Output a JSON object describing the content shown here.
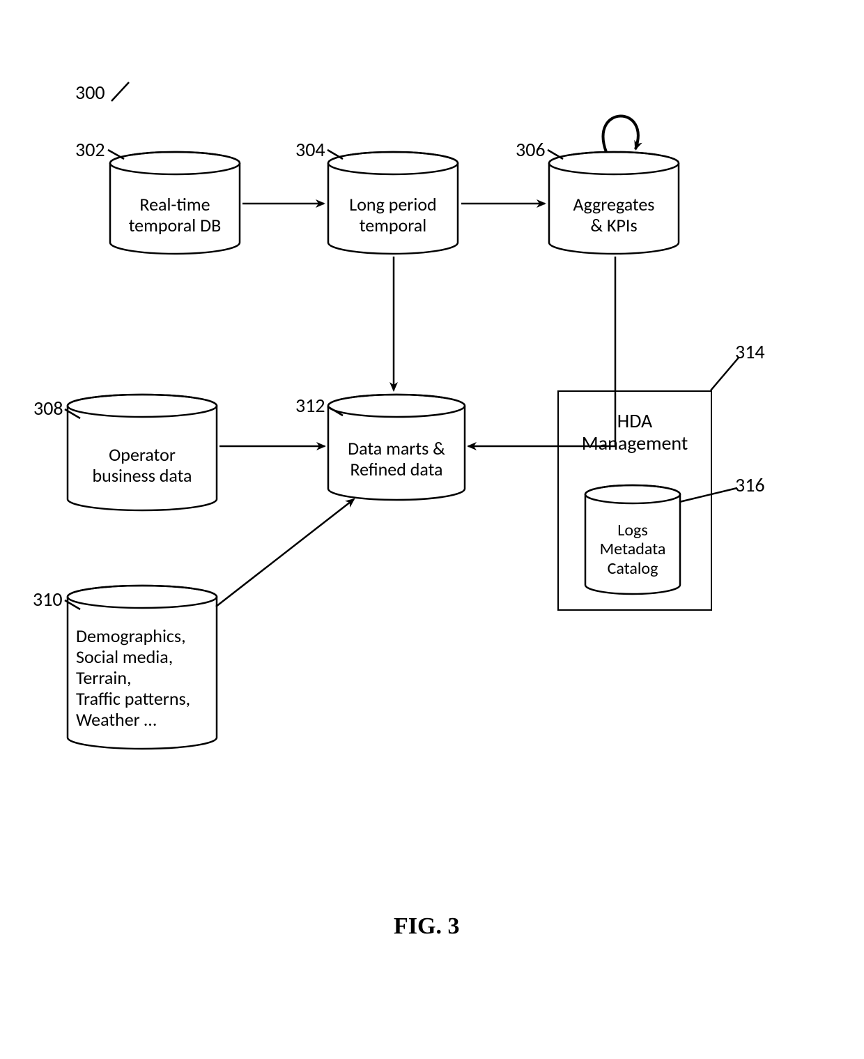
{
  "figure_ref": "300",
  "figure_label": "FIG. 3",
  "nodes": {
    "n302": {
      "ref": "302",
      "lines": [
        "Real-time",
        "temporal DB"
      ]
    },
    "n304": {
      "ref": "304",
      "lines": [
        "Long period",
        "temporal"
      ]
    },
    "n306": {
      "ref": "306",
      "lines": [
        "Aggregates",
        "& KPIs"
      ]
    },
    "n308": {
      "ref": "308",
      "lines": [
        "Operator",
        "business data"
      ]
    },
    "n310": {
      "ref": "310",
      "lines": [
        "Demographics,",
        "Social media,",
        "Terrain,",
        "Traffic patterns,",
        "Weather …"
      ]
    },
    "n312": {
      "ref": "312",
      "lines": [
        "Data marts &",
        "Refined data"
      ]
    },
    "n314": {
      "ref": "314",
      "title_lines": [
        "HDA",
        "Management"
      ]
    },
    "n316": {
      "ref": "316",
      "lines": [
        "Logs",
        "Metadata",
        "Catalog"
      ]
    }
  }
}
